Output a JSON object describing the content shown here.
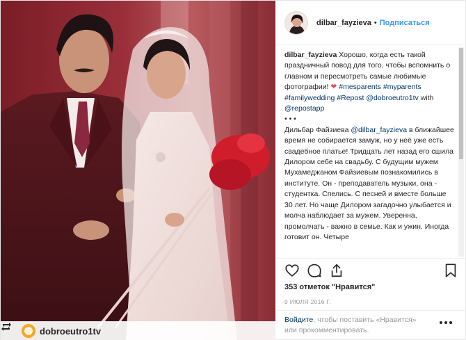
{
  "photo": {
    "repost_user": "dobroeutro1tv"
  },
  "header": {
    "username": "dilbar_fayzieva",
    "separator": "•",
    "follow_label": "Подписаться"
  },
  "caption": {
    "username": "dilbar_fayzieva",
    "lead": " Хорошо, когда есть такой праздничный повод для того, чтобы вспомнить о главном и пересмотреть самые любимые фотографии! ",
    "heart": "❤",
    "hashtag1": "#mesparents",
    "hashtag2": "#myparents",
    "hashtag3": "#familywedding",
    "hashtag4": "#Repost",
    "mention1": "@dobroeutro1tv",
    "with": " with ",
    "mention2": "@repostapp",
    "dots": "• • •",
    "body1": "Дильбар Файзиева ",
    "mention3": "@dilbar_fayzieva",
    "body2": " в ближайшее время не собирается замуж, но у неё уже есть свадебное платье! Тридцать лет назад его сшила Дилором себе на свадьбу. С будущим мужем Мухамеджаном Файзиевым познакомились в институте. Он - преподаватель музыки, она - студентка. Спелись. С песней и вместе больше 30 лет. Но чаще Дилором загадочно улыбается и молча наблюдает за мужем. Уверенна, промолчать - важно в семье. Как и ужин. Иногда готовит он. Четыре"
  },
  "actions": {
    "like_icon": "heart-outline-icon",
    "comment_icon": "comment-bubble-icon",
    "share_icon": "share-icon",
    "save_icon": "bookmark-icon"
  },
  "likes_text": "353 отметок \"Нравится\"",
  "date_text": "9 ИЮЛЯ 2016 Г.",
  "login": {
    "link": "Войдите",
    "text": ", чтобы поставить «Нравится» или прокомментировать."
  },
  "colors": {
    "link_blue": "#3897f0",
    "hashtag_navy": "#003569",
    "heart_red": "#ed4956",
    "muted": "#999999"
  }
}
